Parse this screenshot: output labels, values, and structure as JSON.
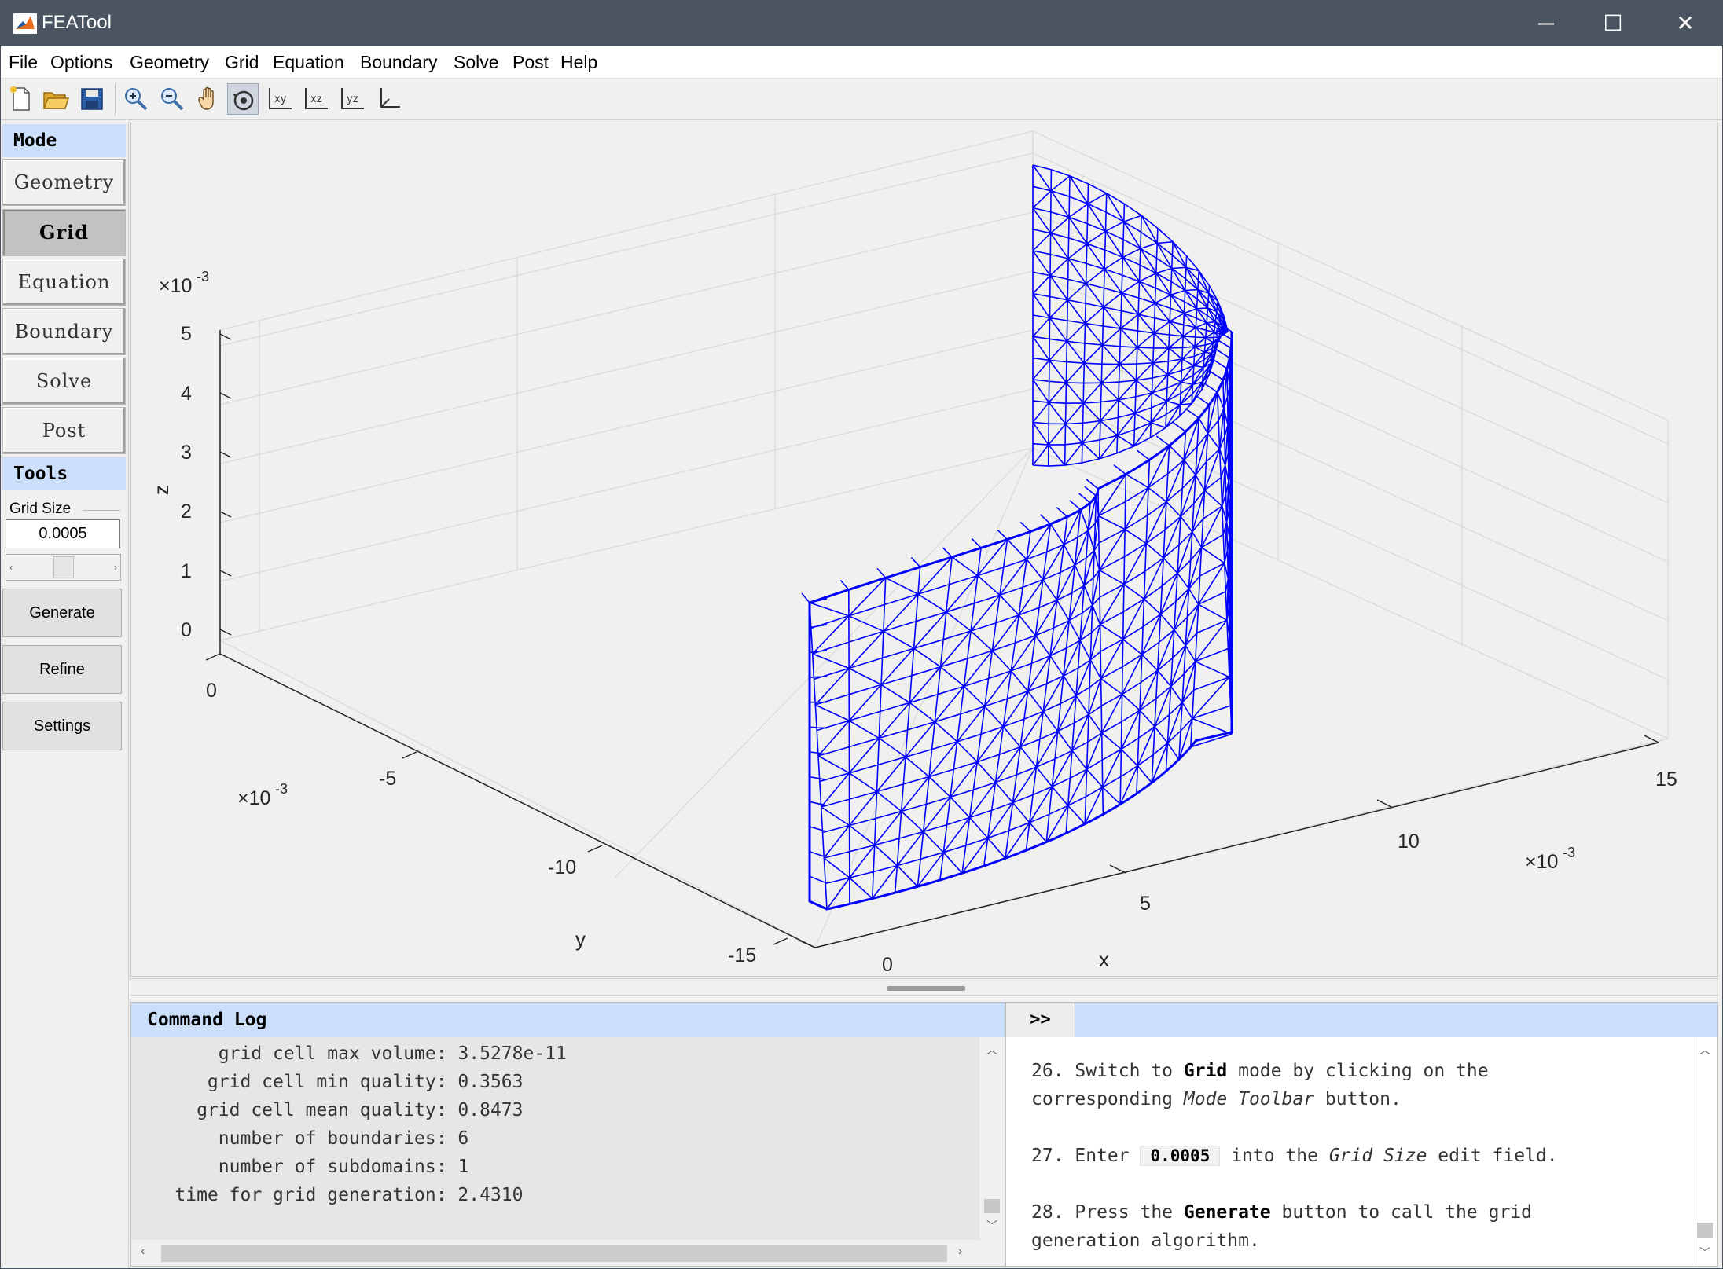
{
  "window": {
    "title": "FEATool",
    "minimize": "─",
    "maximize": "☐",
    "close": "✕"
  },
  "menu": [
    "File",
    "Options",
    "Geometry",
    "Grid",
    "Equation",
    "Boundary",
    "Solve",
    "Post",
    "Help"
  ],
  "toolbar": {
    "icons": [
      "new-file-icon",
      "open-folder-icon",
      "save-icon",
      "zoom-in-icon",
      "zoom-out-icon",
      "pan-hand-icon",
      "rotate-3d-icon",
      "view-xy-icon",
      "view-xz-icon",
      "view-yz-icon",
      "view-3d-icon"
    ],
    "active": "rotate-3d-icon"
  },
  "mode_panel": {
    "header": "Mode",
    "buttons": [
      "Geometry",
      "Grid",
      "Equation",
      "Boundary",
      "Solve",
      "Post"
    ],
    "active": "Grid"
  },
  "tools_panel": {
    "header": "Tools",
    "grid_size_label": "Grid Size",
    "grid_size_value": "0.0005",
    "slider_level": 0.5,
    "buttons": [
      "Generate",
      "Refine",
      "Settings"
    ]
  },
  "plot": {
    "mesh_color": "#0000ff",
    "x_ticks": [
      "0",
      "5",
      "10",
      "15"
    ],
    "y_ticks": [
      "0",
      "-5",
      "-10",
      "-15"
    ],
    "z_ticks": [
      "0",
      "1",
      "2",
      "3",
      "4",
      "5"
    ],
    "x_label": "x",
    "y_label": "y",
    "z_label": "z",
    "exp_base": "×10",
    "exp_power": "-3"
  },
  "command_log": {
    "header": "Command Log",
    "lines": [
      "        grid cell max volume: 3.5278e-11",
      "       grid cell min quality: 0.3563",
      "      grid cell mean quality: 0.8473",
      "        number of boundaries: 6",
      "        number of subdomains: 1",
      "    time for grid generation: 2.4310"
    ]
  },
  "tutorial": {
    "toggle": ">>",
    "step26_a": "26. Switch to ",
    "step26_b": "Grid",
    "step26_c": " mode by clicking on the",
    "step26_d": "corresponding ",
    "step26_e": "Mode Toolbar",
    "step26_f": " button.",
    "step27_a": "27. Enter ",
    "step27_b": "0.0005",
    "step27_c": " into the ",
    "step27_d": "Grid Size",
    "step27_e": " edit field.",
    "step28_a": "28. Press the ",
    "step28_b": "Generate",
    "step28_c": " button to call the grid",
    "step28_d": "generation algorithm."
  },
  "colors": {
    "titlebar": "#4a5461",
    "panel_header": "#cbdffb",
    "mesh": "#0000ff"
  }
}
